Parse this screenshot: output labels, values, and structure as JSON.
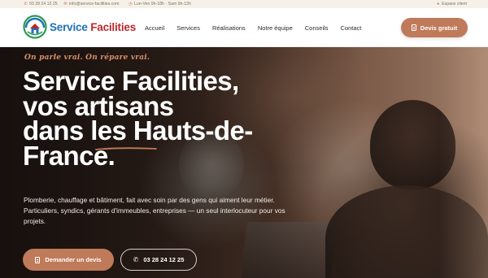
{
  "topbar": {
    "phone": "03 28 24 12 25",
    "email": "info@service-facilities.com",
    "hours": "Lun-Ven 9h-18h · Sam 9h-12h",
    "client_space": "Espace client"
  },
  "logo": {
    "word1": "Service",
    "word2": "Facilities"
  },
  "nav": {
    "items": [
      "Accueil",
      "Services",
      "Réalisations",
      "Notre équipe",
      "Conseils",
      "Contact"
    ]
  },
  "header_cta": "Devis gratuit",
  "hero": {
    "tagline": "On parle vrai. On répare vrai.",
    "title_lines": [
      "Service Facilities,",
      "vos artisans",
      "dans les Hauts-de-",
      "France."
    ],
    "description": "Plomberie, chauffage et bâtiment, fait avec soin par des gens qui aiment leur métier. Particuliers, syndics, gérants d'immeubles, entreprises — un seul interlocuteur pour vos projets.",
    "cta_primary": "Demander un devis",
    "cta_phone": "03 28 24 12 25"
  },
  "colors": {
    "accent": "#bf7a5a",
    "logo_blue": "#1f72b8",
    "logo_red": "#b9282b",
    "topbar_bg": "#f6f1e8"
  },
  "icons": [
    "phone-icon",
    "mail-icon",
    "clock-icon",
    "user-icon",
    "document-icon"
  ]
}
